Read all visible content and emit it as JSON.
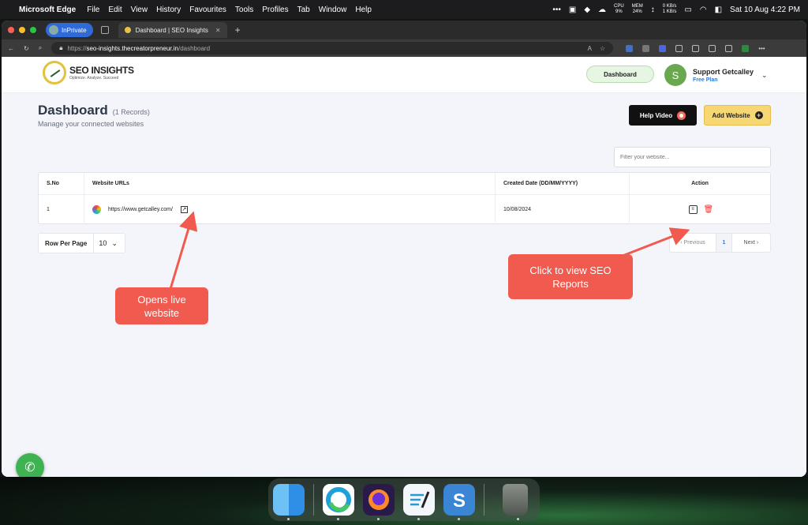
{
  "menubar": {
    "app": "Microsoft Edge",
    "items": [
      "File",
      "Edit",
      "View",
      "History",
      "Favourites",
      "Tools",
      "Profiles",
      "Tab",
      "Window",
      "Help"
    ],
    "cpu_label": "CPU",
    "cpu_value": "9%",
    "mem_label": "MEM",
    "mem_value": "24%",
    "net_up": "0 KB/s",
    "net_down": "1 KB/s",
    "datetime": "Sat 10 Aug 4:22 PM"
  },
  "browser": {
    "inprivate": "InPrivate",
    "tab_title": "Dashboard | SEO Insights",
    "url_scheme": "https://",
    "url_host": "seo-insights.thecreatorpreneur.in",
    "url_path": "/dashboard"
  },
  "header": {
    "logo_name": "SEO INSIGHTS",
    "logo_tagline": "Optimize. Analyze. Succeed",
    "dashboard_button": "Dashboard",
    "user_initial": "S",
    "user_name": "Support Getcalley",
    "user_plan": "Free Plan"
  },
  "page": {
    "title": "Dashboard",
    "record_count": "(1 Records)",
    "subtitle": "Manage your connected websites",
    "help_button": "Help Video",
    "add_button": "Add Website",
    "filter_placeholder": "Filter your website..."
  },
  "table": {
    "headers": [
      "S.No",
      "Website URLs",
      "Created Date (DD/MM/YYYY)",
      "Action"
    ],
    "rows": [
      {
        "sno": "1",
        "url": "https://www.getcalley.com/",
        "created": "10/08/2024"
      }
    ]
  },
  "pagination": {
    "rows_per_page_label": "Row Per Page",
    "rows_per_page_value": "10",
    "prev": "Previous",
    "page": "1",
    "next": "Next"
  },
  "annotations": {
    "live": "Opens live website",
    "reports": "Click to view SEO Reports"
  },
  "colors": {
    "callout": "#f15a4e",
    "accent_yellow": "#f7d774",
    "link_blue": "#2e7bd6"
  }
}
